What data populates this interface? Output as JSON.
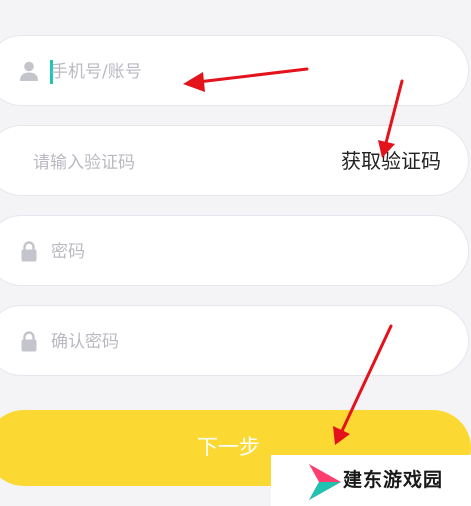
{
  "form": {
    "phone_placeholder": "手机号/账号",
    "code_placeholder": "请输入验证码",
    "get_code_label": "获取验证码",
    "password_placeholder": "密码",
    "confirm_placeholder": "确认密码",
    "next_label": "下一步"
  },
  "watermark": {
    "text": "建东游戏园"
  },
  "colors": {
    "accent": "#fcd932",
    "caret": "#20c6b4",
    "annotation_arrow": "#e3121b"
  },
  "icons": {
    "phone_field": "user-icon",
    "password_field": "lock-icon",
    "confirm_field": "lock-icon"
  }
}
